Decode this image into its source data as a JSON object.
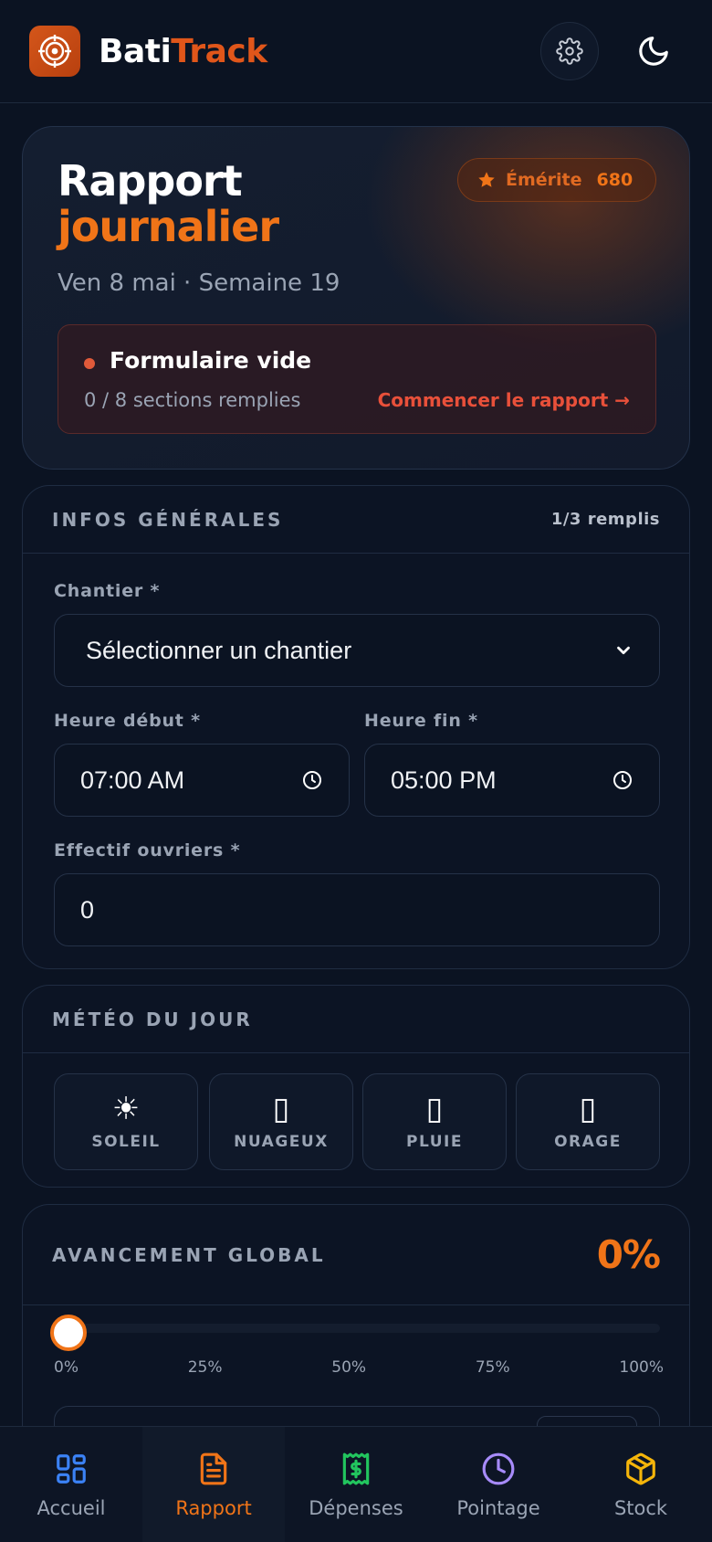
{
  "header": {
    "brand_part1": "Bati",
    "brand_part2": "Track",
    "icons": [
      "logo-target-icon",
      "gear-icon",
      "moon-icon"
    ]
  },
  "hero": {
    "title_line1": "Rapport",
    "title_line2": "journalier",
    "subtitle": "Ven 8 mai · Semaine 19",
    "badge": {
      "level": "Émérite",
      "points": "680"
    },
    "status": {
      "title": "Formulaire vide",
      "count": "0 / 8 sections remplies",
      "cta": "Commencer le rapport →"
    }
  },
  "infos": {
    "section_label": "INFOS GÉNÉRALES",
    "filled": "1/3 remplis",
    "chantier_label": "Chantier *",
    "chantier_value": "Sélectionner un chantier",
    "start_label": "Heure début *",
    "start_value": "07:00 AM",
    "end_label": "Heure fin *",
    "end_value": "05:00 PM",
    "workers_label": "Effectif ouvriers *",
    "workers_value": "0"
  },
  "weather": {
    "section_label": "MÉTÉO DU JOUR",
    "options": [
      {
        "glyph": "☀",
        "label": "SOLEIL"
      },
      {
        "glyph": "▯",
        "label": "NUAGEUX"
      },
      {
        "glyph": "▯",
        "label": "PLUIE"
      },
      {
        "glyph": "▯",
        "label": "ORAGE"
      }
    ]
  },
  "progress": {
    "section_label": "AVANCEMENT GLOBAL",
    "value_label": "0%",
    "value": 0,
    "ticks": [
      "0%",
      "25%",
      "50%",
      "75%",
      "100%"
    ]
  },
  "nav": {
    "items": [
      {
        "label": "Accueil",
        "icon": "grid-icon"
      },
      {
        "label": "Rapport",
        "icon": "document-icon"
      },
      {
        "label": "Dépenses",
        "icon": "receipt-dollar-icon"
      },
      {
        "label": "Pointage",
        "icon": "clock-icon"
      },
      {
        "label": "Stock",
        "icon": "box-icon"
      }
    ],
    "active": "Rapport"
  },
  "colors": {
    "accent": "#f07418",
    "background": "#0b1322",
    "danger": "#e8503a"
  }
}
